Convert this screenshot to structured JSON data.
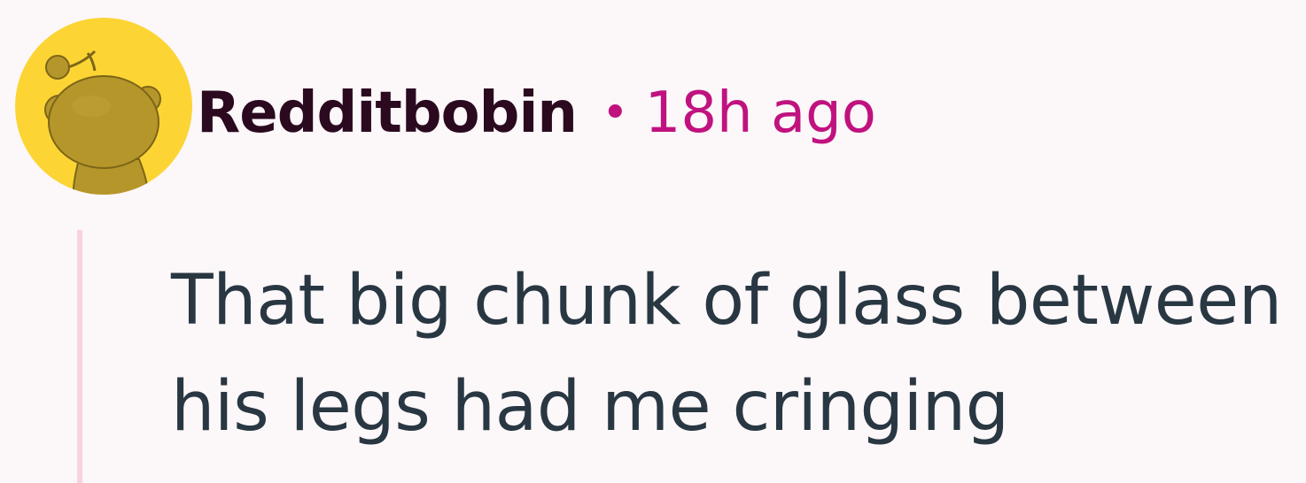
{
  "comment": {
    "username": "Redditbobin",
    "separator": "•",
    "timestamp": "18h ago",
    "body": "That big chunk of glass between his legs had me cringing"
  },
  "avatar": {
    "icon": "snoo-avatar-icon",
    "background_color": "#fcd535",
    "figure_color": "#b5962a"
  },
  "colors": {
    "page_background": "#fcf7f9",
    "username": "#2b0a1f",
    "timestamp": "#c0127f",
    "body_text": "#283742",
    "thread_line": "#f9d2df"
  }
}
